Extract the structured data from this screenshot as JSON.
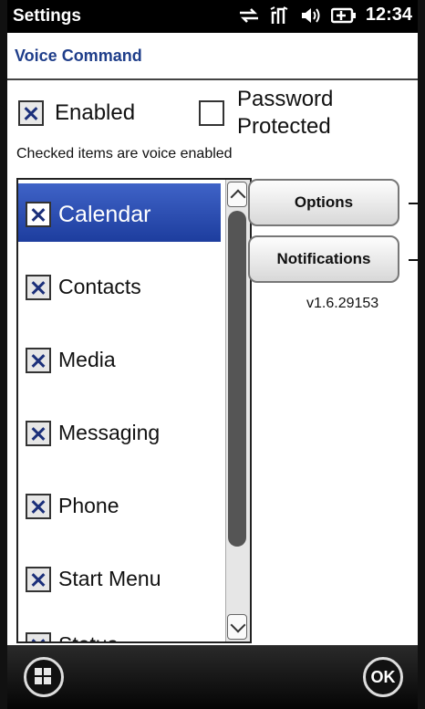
{
  "statusbar": {
    "app_title": "Settings",
    "time": "12:34",
    "icons": [
      "sync-arrows-icon",
      "signal-icon",
      "volume-icon",
      "battery-icon"
    ]
  },
  "header": {
    "title": "Voice Command"
  },
  "options": {
    "enabled_label": "Enabled",
    "enabled_checked": true,
    "password_label_line1": "Password",
    "password_label_line2": "Protected",
    "password_checked": false,
    "hint": "Checked items are voice enabled"
  },
  "list": {
    "items": [
      {
        "label": "Calendar",
        "checked": true,
        "selected": true
      },
      {
        "label": "Contacts",
        "checked": true,
        "selected": false
      },
      {
        "label": "Media",
        "checked": true,
        "selected": false
      },
      {
        "label": "Messaging",
        "checked": true,
        "selected": false
      },
      {
        "label": "Phone",
        "checked": true,
        "selected": false
      },
      {
        "label": "Start Menu",
        "checked": true,
        "selected": false
      },
      {
        "label": "Status",
        "checked": true,
        "selected": false
      }
    ]
  },
  "buttons": {
    "options_label": "Options",
    "notifications_label": "Notifications"
  },
  "version": "v1.6.29153",
  "bottombar": {
    "ok_label": "OK"
  },
  "colors": {
    "accent_blue": "#1f3e8a",
    "selection_blue": "#2a4db3"
  }
}
